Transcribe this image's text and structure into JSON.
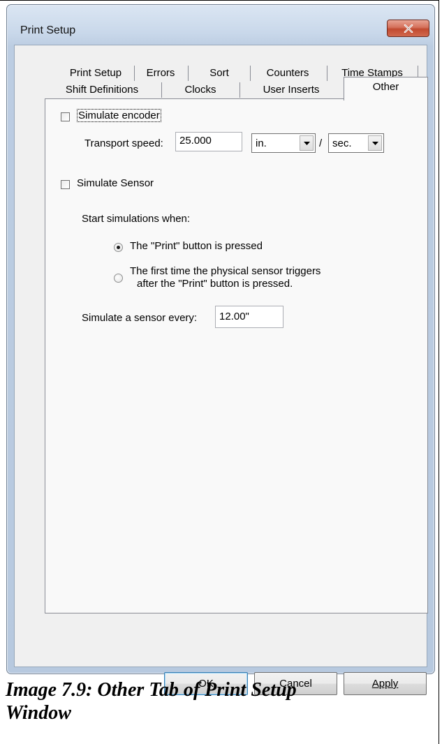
{
  "window": {
    "title": "Print Setup",
    "close_label": "x"
  },
  "tabs": {
    "row1": [
      "Print Setup",
      "Errors",
      "Sort",
      "Counters",
      "Time Stamps"
    ],
    "row2": [
      "Shift Definitions",
      "Clocks",
      "User Inserts",
      "Other"
    ],
    "active": "Other"
  },
  "other_tab": {
    "simulate_encoder": {
      "label": "Simulate encoder",
      "checked": false
    },
    "transport_speed": {
      "label": "Transport speed:",
      "value": "25.000",
      "unit_distance": "in.",
      "separator": "/",
      "unit_time": "sec."
    },
    "simulate_sensor": {
      "label": "Simulate Sensor",
      "checked": false
    },
    "start_label": "Start simulations when:",
    "start_options": [
      {
        "label": "The \"Print\" button is pressed",
        "selected": true
      },
      {
        "label_line1": "The first time the physical sensor triggers",
        "label_line2": "after the \"Print\" button is pressed.",
        "selected": false
      }
    ],
    "sensor_every": {
      "label": "Simulate a sensor every:",
      "value": "12.00\""
    }
  },
  "buttons": {
    "ok": "OK",
    "cancel": "Cancel",
    "apply": "Apply"
  },
  "caption": {
    "line1": "Image 7.9: Other Tab of Print Setup",
    "line2": "Window"
  }
}
